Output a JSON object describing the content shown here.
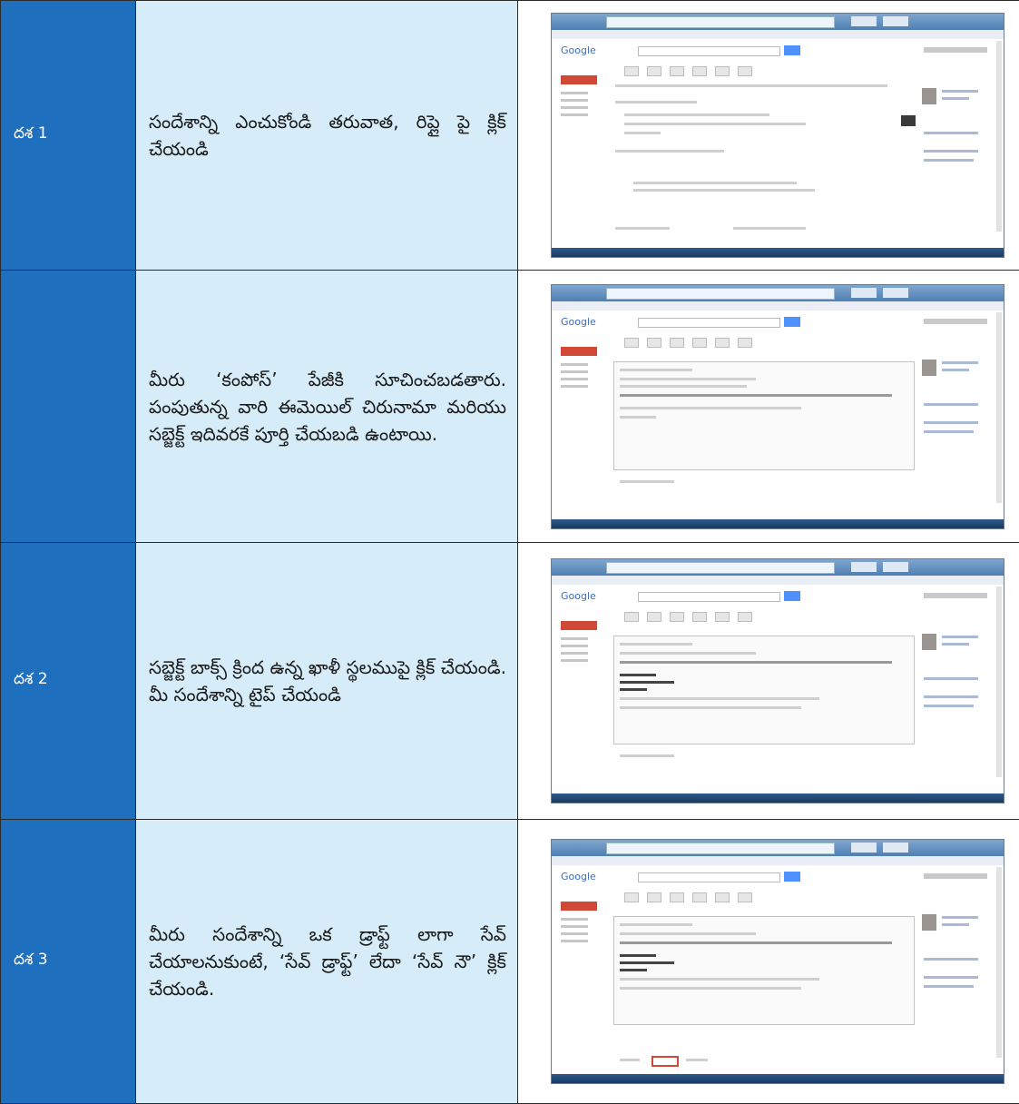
{
  "rows": [
    {
      "step": "దశ 1",
      "description": "సందేశాన్ని ఎంచుకోండి తరువాత, రిప్లై పై క్లిక్ చేయండి",
      "screenshot": "gmail-message-view"
    },
    {
      "step": "",
      "description": "మీరు ‘కంపోస్’ పేజీకి సూచించబడతారు. పంపుతున్న వారి ఈమెయిల్ చిరునామా మరియు సబ్జెక్ట్ ఇదివరకే పూర్తి చేయబడి ఉంటాయి.",
      "screenshot": "gmail-compose-reply"
    },
    {
      "step": "దశ 2",
      "description": "సబ్జెక్ట్ బాక్స్ క్రింద ఉన్న ఖాళీ స్థలముపై క్లిక్ చేయండి. మీ సందేశాన్ని టైప్ చేయండి",
      "screenshot": "gmail-typing-message"
    },
    {
      "step": "దశ 3",
      "description": "మీరు సందేశాన్ని ఒక డ్రాఫ్ట్ లాగా సేవ్ చేయాలనుకుంటే, ‘సేవ్ డ్రాఫ్ట్’ లేదా ‘సేవ్ నౌ’ క్లిక్ చేయండి.",
      "screenshot": "gmail-save-draft-highlighted"
    }
  ],
  "colors": {
    "step_column": "#1f6fbf",
    "description_column": "#d6ecf8",
    "highlight": "#d14836"
  }
}
